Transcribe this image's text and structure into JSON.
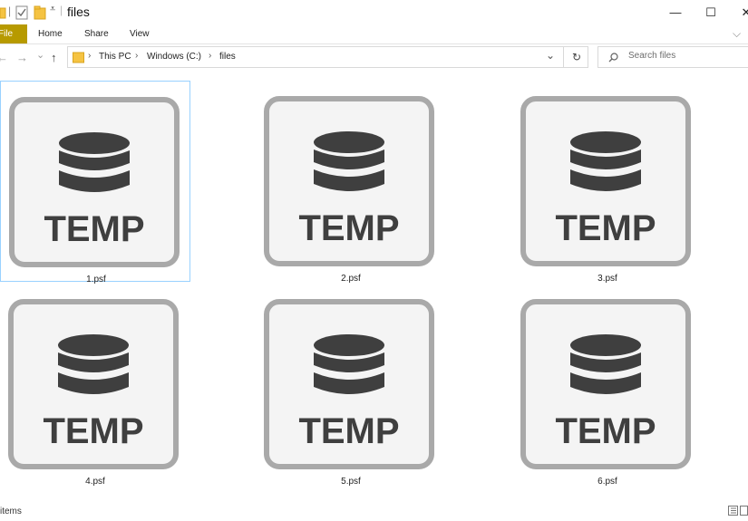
{
  "window": {
    "title": "files",
    "minimize_glyph": "—",
    "maximize_glyph": "☐",
    "close_glyph": "✕"
  },
  "ribbon": {
    "tabs": [
      {
        "label": "File"
      },
      {
        "label": "Home"
      },
      {
        "label": "Share"
      },
      {
        "label": "View"
      }
    ],
    "expand_glyph": "⌵"
  },
  "nav": {
    "back_glyph": "←",
    "forward_glyph": "→",
    "recent_glyph": "⌄",
    "up_glyph": "↑",
    "breadcrumb": [
      "This PC",
      "Windows (C:)",
      "files"
    ],
    "breadcrumb_sep": "›",
    "dropdown_glyph": "⌄",
    "refresh_glyph": "↻"
  },
  "search": {
    "placeholder": "Search files"
  },
  "files": [
    {
      "name": "1.psf",
      "icon_text": "TEMP",
      "selected": true
    },
    {
      "name": "2.psf",
      "icon_text": "TEMP",
      "selected": false
    },
    {
      "name": "3.psf",
      "icon_text": "TEMP",
      "selected": false
    },
    {
      "name": "4.psf",
      "icon_text": "TEMP",
      "selected": false
    },
    {
      "name": "5.psf",
      "icon_text": "TEMP",
      "selected": false
    },
    {
      "name": "6.psf",
      "icon_text": "TEMP",
      "selected": false
    }
  ],
  "status": {
    "text": "items"
  },
  "colors": {
    "file_tab": "#b79a00",
    "selection_border": "#99d1ff",
    "icon_frame": "#a9a9a9",
    "icon_fill": "#f4f4f4",
    "icon_glyph": "#3f3f3f"
  }
}
